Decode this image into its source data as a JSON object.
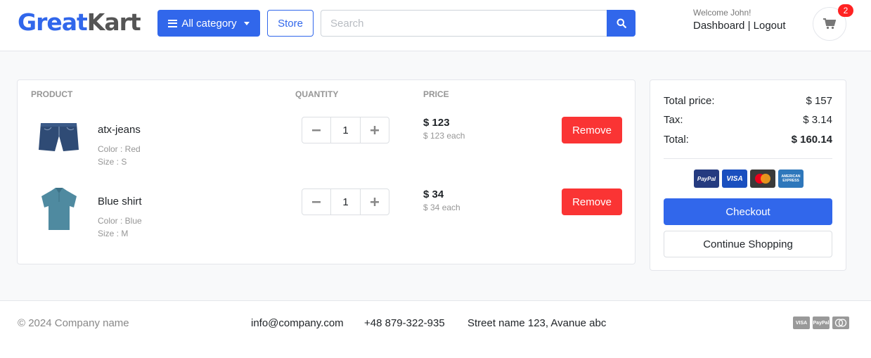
{
  "header": {
    "logo": {
      "part1": "Great",
      "part2": "Kart"
    },
    "category_button": "All category",
    "store_button": "Store",
    "search": {
      "placeholder": "Search",
      "value": ""
    },
    "welcome": "Welcome John!",
    "dashboard_link": "Dashboard",
    "separator": "|",
    "logout_link": "Logout",
    "cart_count": "2"
  },
  "cart": {
    "columns": {
      "product": "Product",
      "quantity": "Quantity",
      "price": "Price"
    },
    "items": [
      {
        "name": "atx-jeans",
        "color": "Color : Red",
        "size": "Size : S",
        "quantity": "1",
        "price": "$ 123",
        "each": "$ 123 each",
        "remove": "Remove"
      },
      {
        "name": "Blue shirt",
        "color": "Color : Blue",
        "size": "Size : M",
        "quantity": "1",
        "price": "$ 34",
        "each": "$ 34 each",
        "remove": "Remove"
      }
    ]
  },
  "summary": {
    "total_price_label": "Total price:",
    "total_price": "$ 157",
    "tax_label": "Tax:",
    "tax": "$ 3.14",
    "total_label": "Total:",
    "total": "$ 160.14",
    "payment_icons": [
      "PayPal",
      "VISA",
      "mastercard",
      "AMERICAN EXPRESS"
    ],
    "checkout": "Checkout",
    "continue": "Continue Shopping"
  },
  "footer": {
    "copyright": "© 2024 Company name",
    "email": "info@company.com",
    "phone": "+48 879-322-935",
    "address": "Street name 123, Avanue abc",
    "payment_icons": [
      "VISA",
      "PayPal",
      "mastercard"
    ]
  },
  "colors": {
    "primary": "#3167eb",
    "danger": "#fa3434",
    "muted": "#969696",
    "background": "#f8f9fa"
  }
}
